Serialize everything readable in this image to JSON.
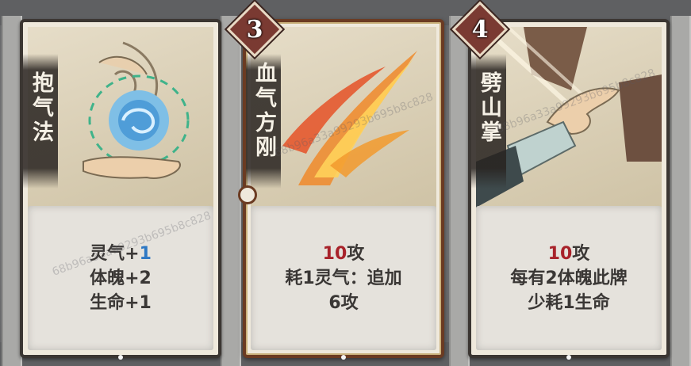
{
  "cards": [
    {
      "name": "抱气法",
      "cost": "",
      "lines": [
        {
          "prefix": "灵气+",
          "accent": "1",
          "accent_color": "blue",
          "suffix": ""
        },
        {
          "prefix": "体魄+2",
          "accent": "",
          "accent_color": "",
          "suffix": ""
        },
        {
          "prefix": "生命+1",
          "accent": "",
          "accent_color": "",
          "suffix": ""
        }
      ],
      "art_icon": "swirl-energy-hands-icon",
      "selected": false
    },
    {
      "name": "血气方刚",
      "cost": "3",
      "lines": [
        {
          "prefix": "",
          "accent": "10",
          "accent_color": "red",
          "suffix": "攻"
        },
        {
          "prefix": "耗1灵气：追加",
          "accent": "",
          "accent_color": "",
          "suffix": ""
        },
        {
          "prefix": "6攻",
          "accent": "",
          "accent_color": "",
          "suffix": ""
        }
      ],
      "art_icon": "flame-slash-icon",
      "selected": true
    },
    {
      "name": "劈山掌",
      "cost": "4",
      "lines": [
        {
          "prefix": "",
          "accent": "10",
          "accent_color": "red",
          "suffix": "攻"
        },
        {
          "prefix": "每有2体魄此牌",
          "accent": "",
          "accent_color": "",
          "suffix": ""
        },
        {
          "prefix": "少耗1生命",
          "accent": "",
          "accent_color": "",
          "suffix": ""
        }
      ],
      "art_icon": "palm-strike-icon",
      "selected": false
    }
  ],
  "watermark": "68b96a33a99293b695b8c828",
  "colors": {
    "red": "#a8222a",
    "blue": "#2e78c4",
    "cost_badge": "#7a3a32"
  }
}
